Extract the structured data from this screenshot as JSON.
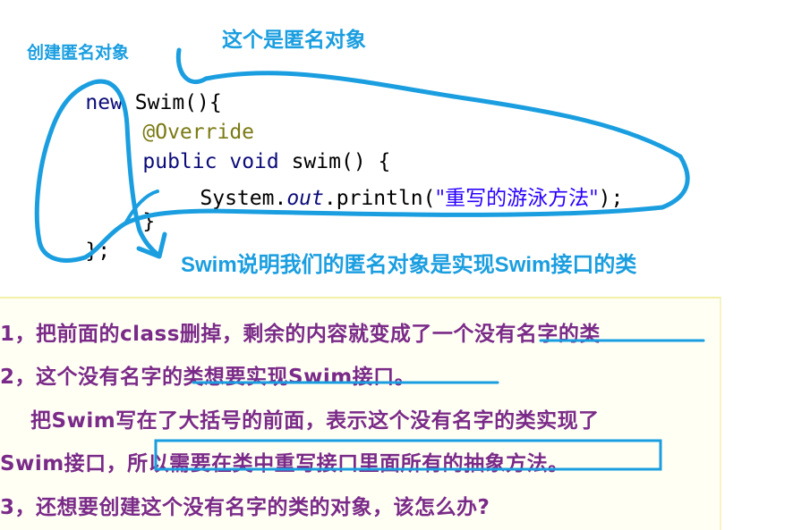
{
  "code": {
    "line1_kw": "new",
    "line1_rest": " Swim(){",
    "line2": "@Override",
    "line3_kw1": "public",
    "line3_kw2": "void",
    "line3_rest": " swim() {",
    "line4_pre": "System.",
    "line4_field": "out",
    "line4_mid": ".println(",
    "line4_str": "\"重写的游泳方法\"",
    "line4_end": ");",
    "line5": "}",
    "line6": "};"
  },
  "annotations": {
    "create_anon": "创建匿名对象",
    "this_is_anon": "这个是匿名对象",
    "swim_explain": "Swim说明我们的匿名对象是实现Swim接口的类"
  },
  "slide": {
    "line1": "1，把前面的class删掉，剩余的内容就变成了一个没有名字的类",
    "line2": "2，这个没有名字的类想要实现Swim接口。",
    "line3": "把Swim写在了大括号的前面，表示这个没有名字的类实现了",
    "line4": "Swim接口，所以需要在类中重写接口里面所有的抽象方法。",
    "line5": "3，还想要创建这个没有名字的类的对象，该怎么办?"
  },
  "colors": {
    "annotation_blue": "#1a9ee0",
    "slide_text": "#7a2a88",
    "keyword": "#0b0b7a",
    "string": "#2a00ff",
    "annotation_at": "#7a7a14"
  }
}
